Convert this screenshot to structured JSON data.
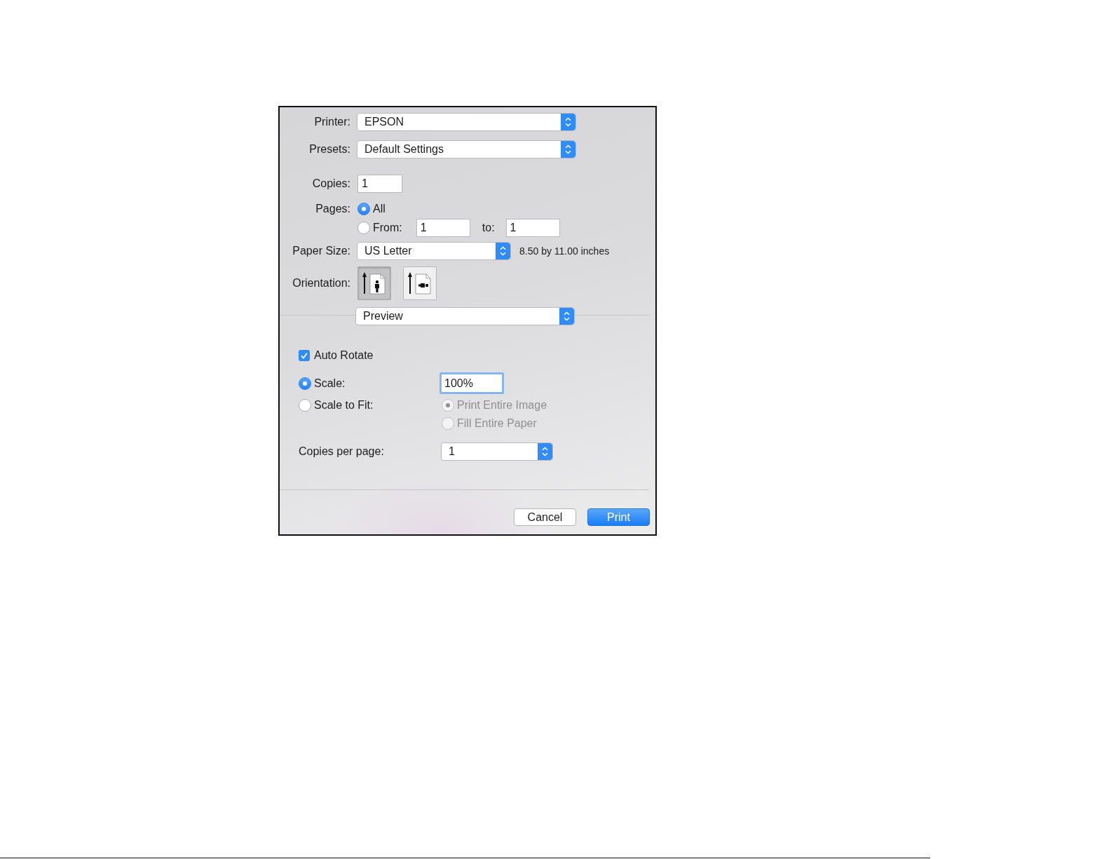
{
  "dialog": {
    "printer": {
      "label": "Printer:",
      "value": "EPSON"
    },
    "presets": {
      "label": "Presets:",
      "value": "Default Settings"
    },
    "copies": {
      "label": "Copies:",
      "value": "1"
    },
    "pages": {
      "label": "Pages:",
      "options": [
        {
          "label": "All",
          "selected": true
        },
        {
          "label": "From:",
          "selected": false,
          "from": "1",
          "to_label": "to:",
          "to": "1"
        }
      ]
    },
    "paper_size": {
      "label": "Paper Size:",
      "value": "US Letter",
      "note": "8.50 by 11.00 inches"
    },
    "orientation": {
      "label": "Orientation:",
      "options": [
        {
          "kind": "portrait",
          "selected": true
        },
        {
          "kind": "landscape",
          "selected": false
        }
      ]
    },
    "section_menu": {
      "value": "Preview"
    },
    "auto_rotate": {
      "label": "Auto Rotate",
      "checked": true
    },
    "scale_mode": [
      {
        "kind": "scale",
        "label": "Scale:",
        "selected": true,
        "value": "100%",
        "focused": true
      },
      {
        "kind": "fit",
        "label": "Scale to Fit:",
        "selected": false,
        "options": [
          {
            "label": "Print Entire Image",
            "selected": true,
            "disabled": true
          },
          {
            "label": "Fill Entire Paper",
            "selected": false,
            "disabled": true
          }
        ]
      }
    ],
    "copies_per_page": {
      "label": "Copies per page:",
      "value": "1"
    },
    "buttons": [
      {
        "label": "Cancel",
        "kind": "secondary"
      },
      {
        "label": "Print",
        "kind": "default"
      }
    ]
  }
}
